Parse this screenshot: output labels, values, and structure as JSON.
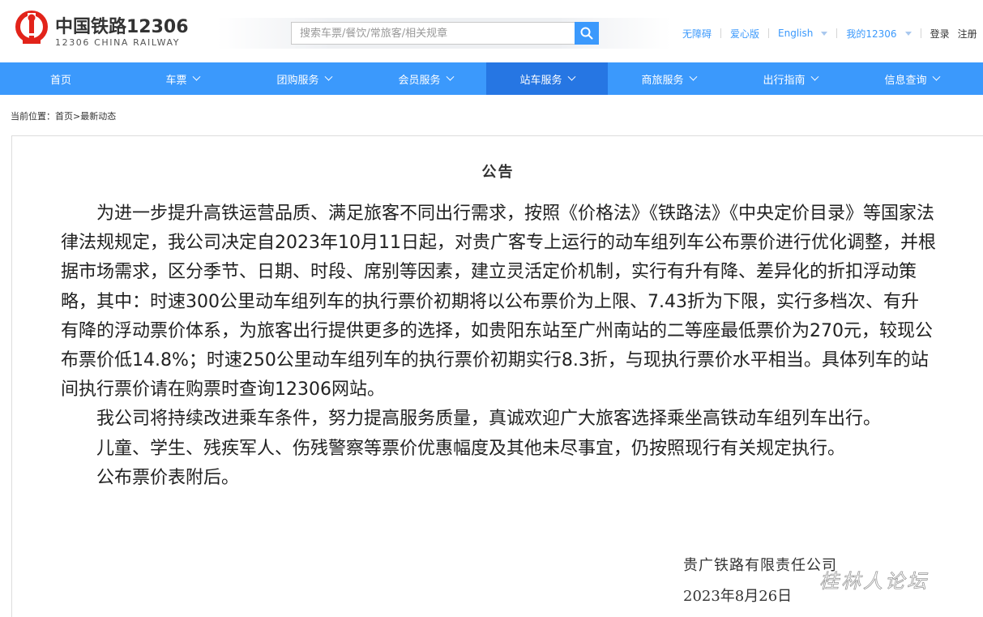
{
  "header": {
    "logo_cn": "中国铁路12306",
    "logo_en": "12306 CHINA RAILWAY",
    "search_placeholder": "搜索车票/餐饮/常旅客/相关规章",
    "links": {
      "accessibility": "无障碍",
      "care": "爱心版",
      "english": "English",
      "my12306": "我的12306",
      "login": "登录",
      "register": "注册"
    }
  },
  "nav": {
    "items": [
      {
        "label": "首页",
        "has_dropdown": false
      },
      {
        "label": "车票",
        "has_dropdown": true
      },
      {
        "label": "团购服务",
        "has_dropdown": true
      },
      {
        "label": "会员服务",
        "has_dropdown": true
      },
      {
        "label": "站车服务",
        "has_dropdown": true,
        "active": true
      },
      {
        "label": "商旅服务",
        "has_dropdown": true
      },
      {
        "label": "出行指南",
        "has_dropdown": true
      },
      {
        "label": "信息查询",
        "has_dropdown": true
      }
    ]
  },
  "breadcrumb": {
    "prefix": "当前位置：",
    "home": "首页",
    "separator": ">",
    "current": "最新动态"
  },
  "notice": {
    "title": "公告",
    "paragraphs": [
      "为进一步提升高铁运营品质、满足旅客不同出行需求，按照《价格法》《铁路法》《中央定价目录》等国家法律法规规定，我公司决定自2023年10月11日起，对贵广客专上运行的动车组列车公布票价进行优化调整，并根据市场需求，区分季节、日期、时段、席别等因素，建立灵活定价机制，实行有升有降、差异化的折扣浮动策略，其中：时速300公里动车组列车的执行票价初期将以公布票价为上限、7.43折为下限，实行多档次、有升有降的浮动票价体系，为旅客出行提供更多的选择，如贵阳东站至广州南站的二等座最低票价为270元，较现公布票价低14.8%；时速250公里动车组列车的执行票价初期实行8.3折，与现执行票价水平相当。具体列车的站间执行票价请在购票时查询12306网站。",
      "我公司将持续改进乘车条件，努力提高服务质量，真诚欢迎广大旅客选择乘坐高铁动车组列车出行。",
      "儿童、学生、残疾军人、伤残警察等票价优惠幅度及其他未尽事宜，仍按照现行有关规定执行。",
      "公布票价表附后。"
    ],
    "signature_org": "贵广铁路有限责任公司",
    "signature_date": "2023年8月26日"
  },
  "watermark": {
    "text": "桂林人论坛"
  },
  "colors": {
    "brand_blue": "#3b99fc",
    "nav_active": "#2676e3",
    "logo_red": "#e2231a"
  }
}
